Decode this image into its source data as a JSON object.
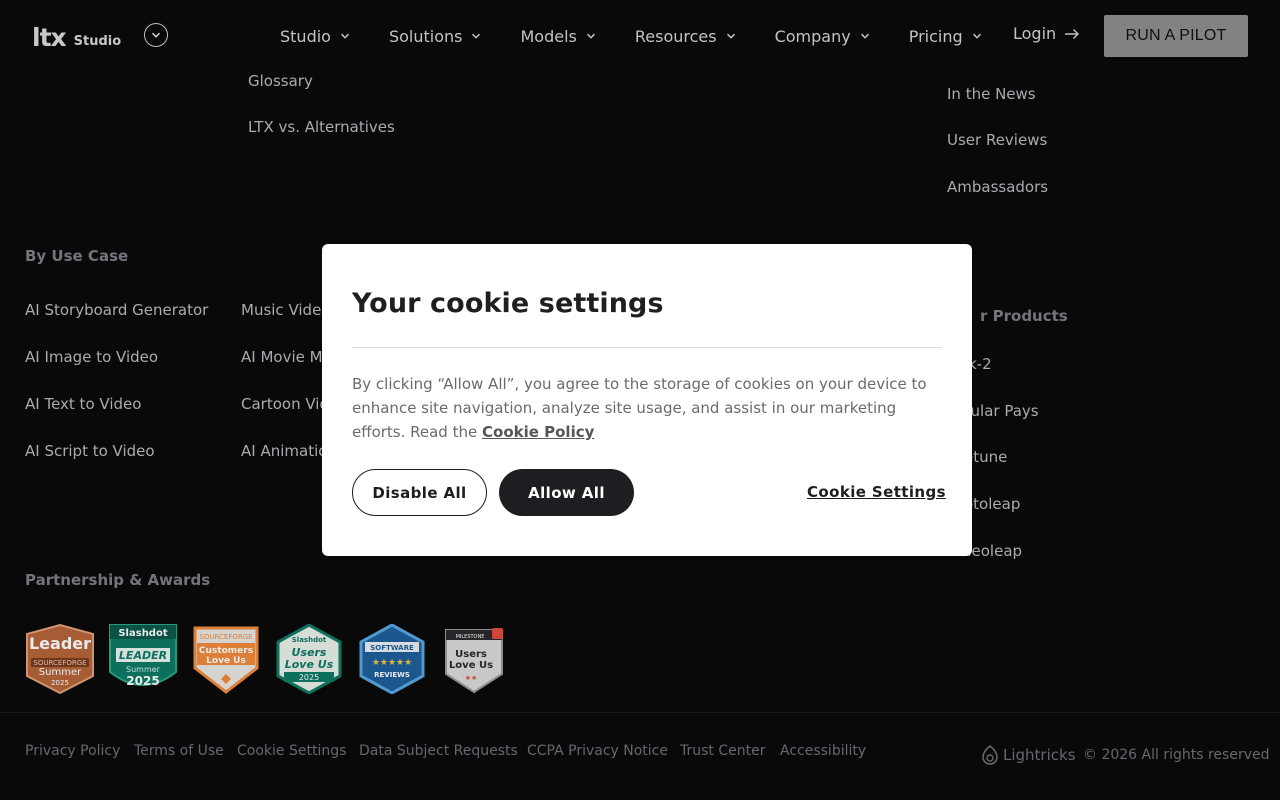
{
  "header": {
    "logo": "LTX",
    "logo_sub": "Studio",
    "nav": [
      {
        "label": "Studio"
      },
      {
        "label": "Solutions"
      },
      {
        "label": "Models"
      },
      {
        "label": "Resources"
      },
      {
        "label": "Company"
      },
      {
        "label": "Pricing"
      }
    ],
    "login": "Login",
    "cta": "RUN A PILOT"
  },
  "footer": {
    "resources_links": [
      "Glossary",
      "LTX vs. Alternatives"
    ],
    "company_links": [
      "In the News",
      "User Reviews",
      "Ambassadors"
    ],
    "by_use_case": {
      "heading": "By Use Case",
      "col1": [
        "AI Storyboard Generator",
        "AI Image to Video",
        "AI Text to Video",
        "AI Script to Video"
      ],
      "col2": [
        "Music Video",
        "AI Movie Ma",
        "Cartoon Vid",
        "AI Animatio"
      ]
    },
    "other_products": {
      "heading": "r Products",
      "items": [
        "k-2",
        "pular Pays",
        "etune",
        "otoleap",
        "deoleap"
      ]
    },
    "awards_heading": "Partnership & Awards",
    "badges": [
      {
        "line1": "Leader",
        "line2": "SOURCEFORGE",
        "line3": "Summer",
        "line4": "2025"
      },
      {
        "line1": "Slashdot",
        "line2": "LEADER",
        "line3": "Summer",
        "line4": "2025"
      },
      {
        "line1": "SOURCEFORGE",
        "line2": "Customers",
        "line3": "Love Us"
      },
      {
        "line1": "Slashdot",
        "line2": "Users",
        "line3": "Love Us",
        "line4": "2025"
      },
      {
        "line1": "SOFTWARE",
        "line2": "REVIEWS"
      },
      {
        "line1": "MILESTONE",
        "line2": "Users",
        "line3": "Love Us"
      }
    ],
    "bottom_links": [
      "Privacy Policy",
      "Terms of Use",
      "Cookie Settings",
      "Data Subject Requests",
      "CCPA Privacy Notice",
      "Trust Center",
      "Accessibility"
    ],
    "brand": "Lightricks",
    "copyright": "© 2026 All rights reserved"
  },
  "cookie_modal": {
    "title": "Your cookie settings",
    "body": "By clicking “Allow All”, you agree to the storage of cookies on your device to enhance site navigation, analyze site usage, and assist in our marketing efforts. Read the",
    "policy_link": "Cookie Policy",
    "disable_label": "Disable All",
    "allow_label": "Allow All",
    "settings_label": "Cookie Settings"
  }
}
